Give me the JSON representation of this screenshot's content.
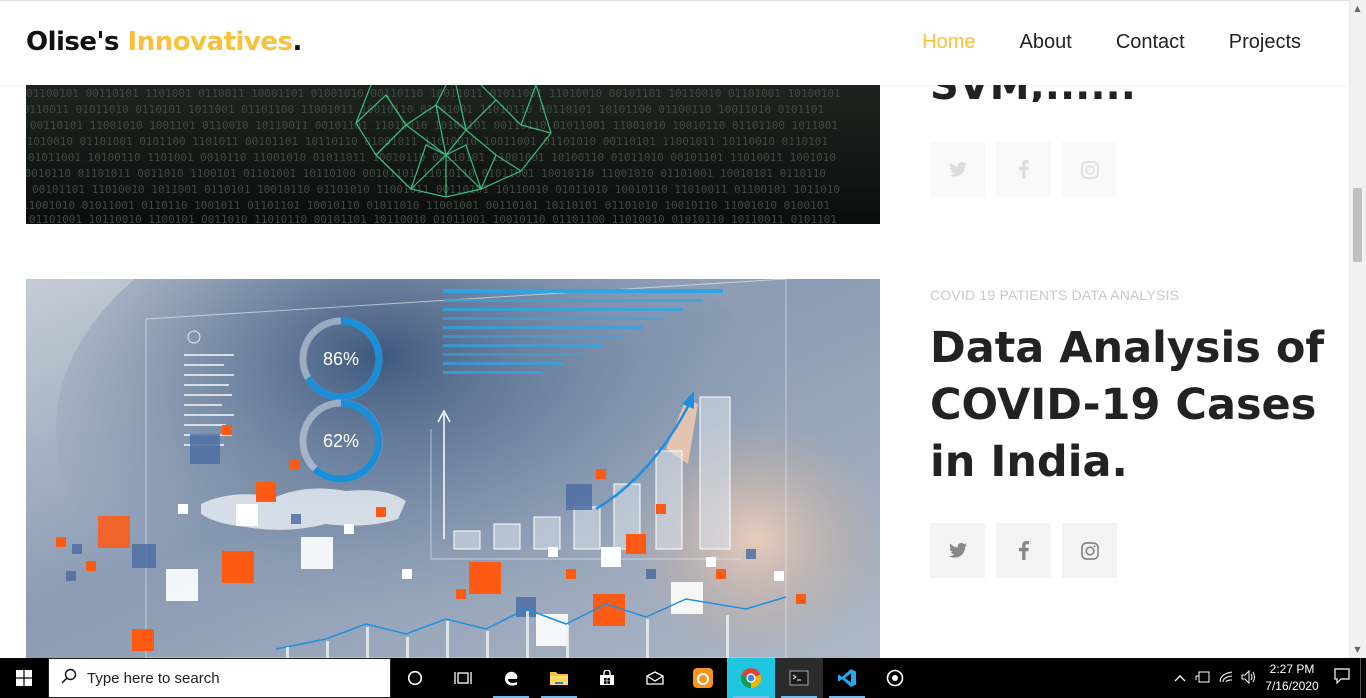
{
  "header": {
    "logo_main": "Olise's",
    "logo_accent": "Innovatives",
    "logo_dot": ".",
    "nav": [
      {
        "label": "Home",
        "active": true
      },
      {
        "label": "About",
        "active": false
      },
      {
        "label": "Contact",
        "active": false
      },
      {
        "label": "Projects",
        "active": false
      }
    ]
  },
  "post1": {
    "title_fragment": "SVM,......"
  },
  "post2": {
    "category": "COVID 19 PATIENTS DATA ANALYSIS",
    "title": "Data Analysis of COVID-19 Cases in India.",
    "image_gauges": [
      "86%",
      "62%"
    ]
  },
  "social_icons": [
    "twitter-icon",
    "facebook-icon",
    "instagram-icon"
  ],
  "taskbar": {
    "search_placeholder": "Type here to search",
    "time": "2:27 PM",
    "date": "7/16/2020"
  },
  "colors": {
    "accent": "#f9c23c",
    "heading": "#222222",
    "category": "#c9c9c9"
  }
}
